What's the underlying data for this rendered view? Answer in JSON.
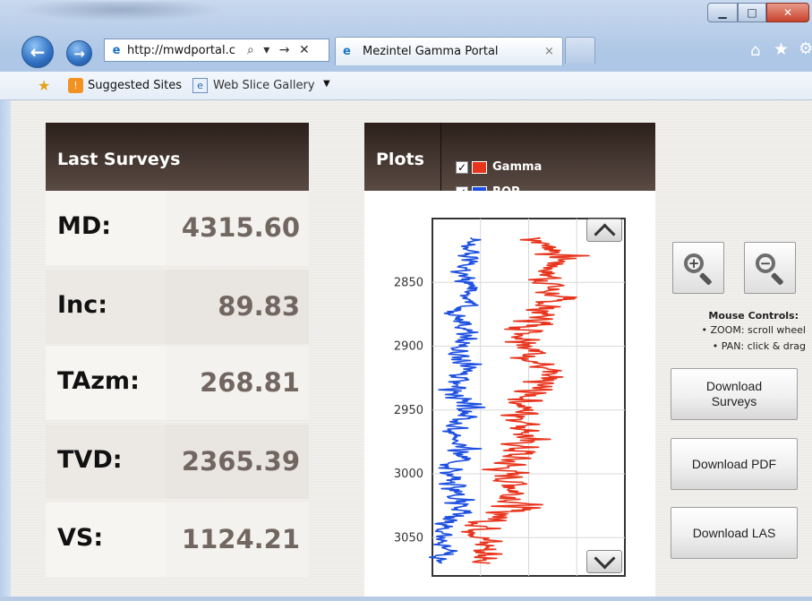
{
  "browser": {
    "address": "http://mwdportal.c",
    "address_tools": "⌕ ▾ → ✕",
    "tab_title": "Mezintel Gamma Portal",
    "tab_close": "×",
    "window_buttons": {
      "minimize": "▁",
      "maximize": "□",
      "close": "✕"
    },
    "nav": {
      "back": "←",
      "forward": "→"
    },
    "toolbar_icons": {
      "home": "⌂",
      "favorites": "★",
      "tools": "⚙"
    },
    "favorites_bar": {
      "suggested_sites": "Suggested Sites",
      "web_slice_gallery": "Web Slice Gallery",
      "caret": "▼"
    }
  },
  "surveys": {
    "title": "Last Surveys",
    "rows": [
      {
        "label": "MD:",
        "value": "4315.60"
      },
      {
        "label": "Inc:",
        "value": "89.83"
      },
      {
        "label": "TAzm:",
        "value": "268.81"
      },
      {
        "label": "TVD:",
        "value": "2365.39"
      },
      {
        "label": "VS:",
        "value": "1124.21"
      }
    ]
  },
  "plots": {
    "title": "Plots",
    "legend": [
      {
        "name": "Gamma",
        "checked": true,
        "color": "#e8341c"
      },
      {
        "name": "ROP",
        "checked": true,
        "color": "#1d4fe0"
      }
    ]
  },
  "chart_data": {
    "type": "line",
    "y_axis_ticks": [
      "2850",
      "2900",
      "2950",
      "3000",
      "3050"
    ],
    "ylim": [
      2800,
      3080
    ],
    "y_inverted": true,
    "series": [
      {
        "name": "Gamma",
        "color": "#e8341c",
        "depth": [
          2815,
          2830,
          2845,
          2860,
          2875,
          2890,
          2905,
          2920,
          2935,
          2950,
          2965,
          2980,
          2995,
          3010,
          3025,
          3040,
          3055,
          3070
        ],
        "values": [
          0.55,
          0.68,
          0.6,
          0.62,
          0.58,
          0.5,
          0.53,
          0.58,
          0.52,
          0.47,
          0.5,
          0.46,
          0.38,
          0.43,
          0.44,
          0.28,
          0.27,
          0.3
        ]
      },
      {
        "name": "ROP",
        "color": "#1d4fe0",
        "depth": [
          2815,
          2830,
          2845,
          2860,
          2875,
          2890,
          2905,
          2920,
          2935,
          2950,
          2965,
          2980,
          2995,
          3010,
          3025,
          3040,
          3055,
          3070
        ],
        "values": [
          0.18,
          0.2,
          0.15,
          0.22,
          0.14,
          0.19,
          0.13,
          0.18,
          0.12,
          0.2,
          0.1,
          0.16,
          0.09,
          0.12,
          0.14,
          0.07,
          0.06,
          0.05
        ]
      }
    ],
    "grid": true
  },
  "controls": {
    "zoom_in_glyph": "+",
    "zoom_out_glyph": "−",
    "mouse_title": "Mouse Controls:",
    "mouse_zoom": "• ZOOM: scroll wheel",
    "mouse_pan": "• PAN: click & drag",
    "download_surveys": "Download\nSurveys",
    "download_pdf": "Download PDF",
    "download_las": "Download LAS"
  }
}
